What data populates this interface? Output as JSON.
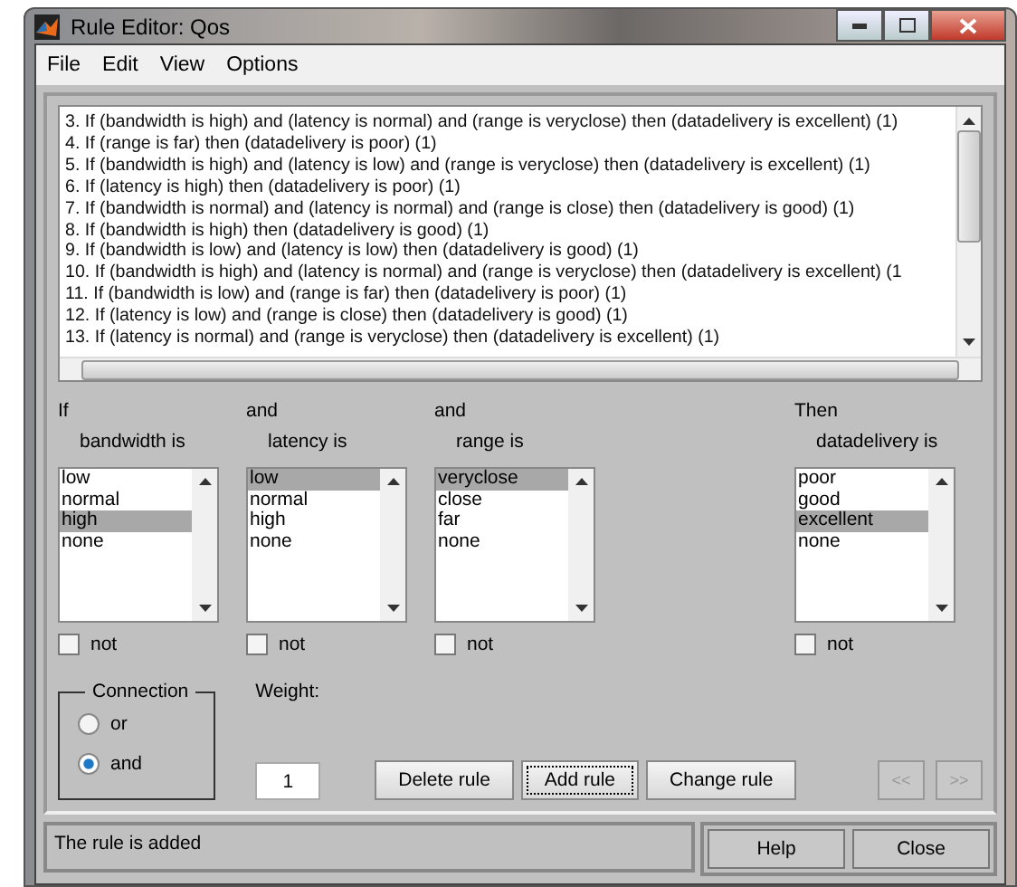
{
  "window": {
    "title": "Rule Editor: Qos"
  },
  "menu": [
    "File",
    "Edit",
    "View",
    "Options"
  ],
  "rules": [
    "3. If (bandwidth is high) and (latency is normal) and (range is veryclose) then (datadelivery is excellent) (1)",
    "4. If (range is far) then (datadelivery is poor) (1)",
    "5. If (bandwidth is high) and (latency is low) and (range is veryclose) then (datadelivery is excellent) (1)",
    "6. If (latency is high) then (datadelivery is poor) (1)",
    "7. If (bandwidth is normal) and (latency is normal) and (range is close) then (datadelivery is good) (1)",
    "8. If (bandwidth is high) then (datadelivery is good) (1)",
    "9. If (bandwidth is low) and (latency is low) then (datadelivery is good) (1)",
    "10. If (bandwidth is high) and (latency is normal) and (range is veryclose) then (datadelivery is excellent) (1",
    "11. If (bandwidth is low) and (range is far) then (datadelivery is poor) (1)",
    "12. If (latency is low) and (range is close) then (datadelivery is good) (1)",
    "13. If (latency is normal) and (range is veryclose) then (datadelivery is excellent) (1)"
  ],
  "variables": [
    {
      "connective": "If",
      "label": "bandwidth is",
      "kind": "input",
      "not": false,
      "not_label": "not",
      "options": [
        {
          "label": "low",
          "selected": false
        },
        {
          "label": "normal",
          "selected": false
        },
        {
          "label": "high",
          "selected": true
        },
        {
          "label": "none",
          "selected": false
        }
      ]
    },
    {
      "connective": "and",
      "label": "latency is",
      "kind": "input",
      "not": false,
      "not_label": "not",
      "options": [
        {
          "label": "low",
          "selected": true
        },
        {
          "label": "normal",
          "selected": false
        },
        {
          "label": "high",
          "selected": false
        },
        {
          "label": "none",
          "selected": false
        }
      ]
    },
    {
      "connective": "and",
      "label": "range is",
      "kind": "input",
      "not": false,
      "not_label": "not",
      "options": [
        {
          "label": "veryclose",
          "selected": true
        },
        {
          "label": "close",
          "selected": false
        },
        {
          "label": "far",
          "selected": false
        },
        {
          "label": "none",
          "selected": false
        }
      ]
    },
    {
      "connective": "Then",
      "label": "datadelivery is",
      "kind": "output",
      "not": false,
      "not_label": "not",
      "options": [
        {
          "label": "poor",
          "selected": false
        },
        {
          "label": "good",
          "selected": false
        },
        {
          "label": "excellent",
          "selected": true
        },
        {
          "label": "none",
          "selected": false
        }
      ]
    }
  ],
  "connection": {
    "title": "Connection",
    "options": [
      {
        "label": "or",
        "selected": false
      },
      {
        "label": "and",
        "selected": true
      }
    ]
  },
  "weight": {
    "label": "Weight:",
    "value": "1"
  },
  "actions": [
    {
      "label": "Delete rule",
      "focused": false
    },
    {
      "label": "Add rule",
      "focused": true
    },
    {
      "label": "Change rule",
      "focused": false
    }
  ],
  "nav": [
    {
      "label": "<<",
      "disabled": true
    },
    {
      "label": ">>",
      "disabled": true
    }
  ],
  "status": "The rule is added",
  "footer_buttons": [
    "Help",
    "Close"
  ]
}
